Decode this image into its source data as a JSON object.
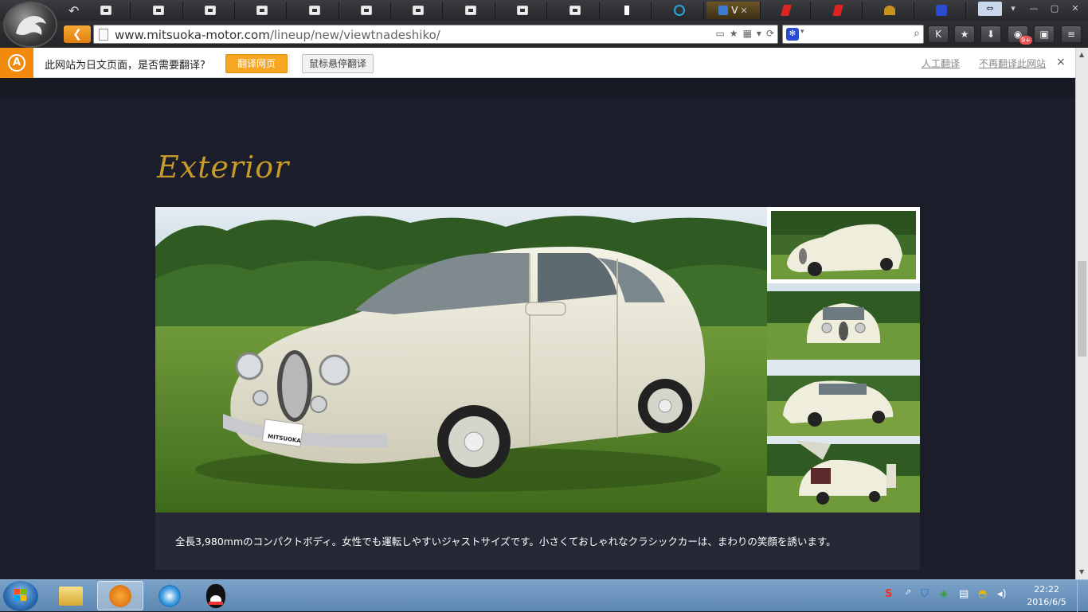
{
  "browser": {
    "url_host": "www.mitsuoka-motor.com",
    "url_path": "/lineup/new/viewtnadeshiko/",
    "active_tab_label": "V",
    "notification_badge": "9+"
  },
  "translate_bar": {
    "question": "此网站为日文页面，是否需要翻译?",
    "translate_button": "翻译网页",
    "hover_button": "鼠标悬停翻译",
    "human_translate_link": "人工翻译",
    "never_translate_link": "不再翻译此网站",
    "close": "×"
  },
  "page": {
    "heading": "Exterior",
    "caption": "全長3,980mmのコンパクトボディ。女性でも運転しやすいジャストサイズです。小さくておしゃれなクラシックカーは、まわりの笑顔を誘います。",
    "plate_text": "MITSUOKA",
    "colors": {
      "heading": "#c69a2b",
      "background": "#1b1d2a",
      "caption_bg": "#262835"
    }
  },
  "taskbar": {
    "time": "22:22",
    "date": "2016/6/5"
  }
}
